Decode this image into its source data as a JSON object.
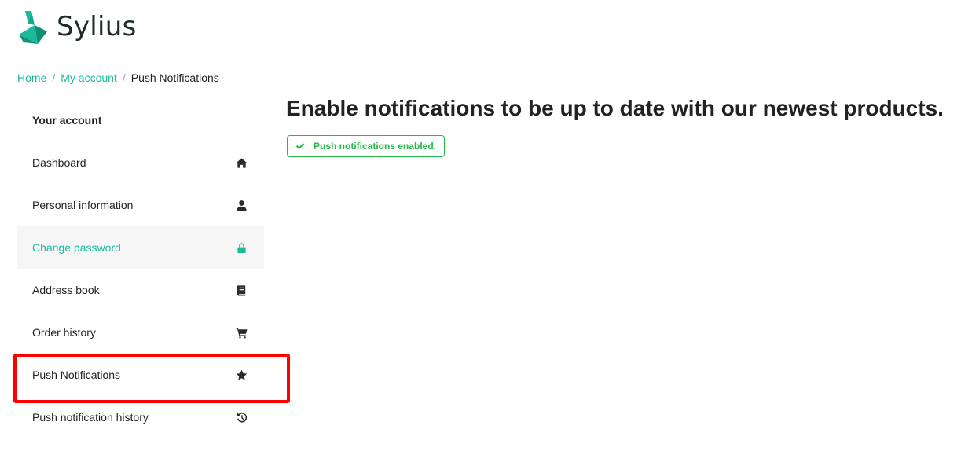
{
  "brand": {
    "name": "Sylius",
    "accent_color": "#1abb9c"
  },
  "breadcrumb": {
    "items": [
      "Home",
      "My account"
    ],
    "current": "Push Notifications"
  },
  "sidebar": {
    "heading": "Your account",
    "items": [
      {
        "label": "Dashboard",
        "icon": "home-icon"
      },
      {
        "label": "Personal information",
        "icon": "user-icon"
      },
      {
        "label": "Change password",
        "icon": "lock-icon",
        "active": true
      },
      {
        "label": "Address book",
        "icon": "book-icon"
      },
      {
        "label": "Order history",
        "icon": "cart-icon"
      },
      {
        "label": "Push Notifications",
        "icon": "star-icon",
        "highlighted": true
      },
      {
        "label": "Push notification history",
        "icon": "history-icon"
      }
    ]
  },
  "main": {
    "title": "Enable notifications to be up to date with our newest products.",
    "alert": {
      "text": "Push notifications enabled.",
      "color": "#21ba45"
    }
  }
}
